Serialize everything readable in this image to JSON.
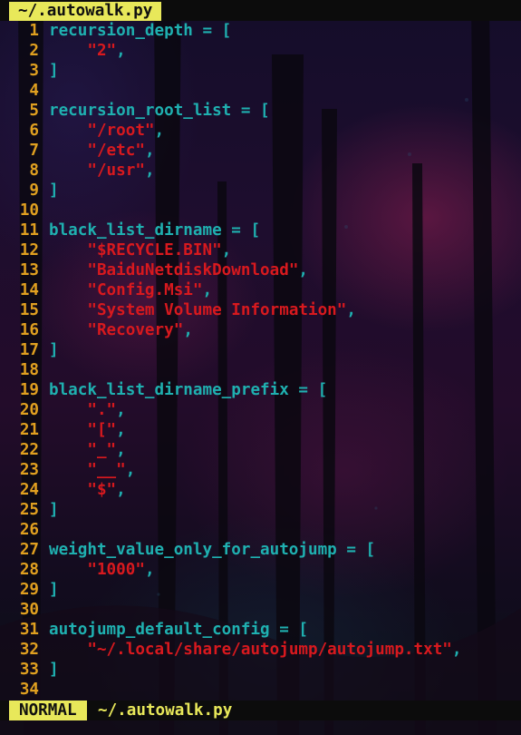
{
  "tabline": {
    "active_tab": "~/.autowalk.py"
  },
  "lines": [
    {
      "n": "1",
      "tokens": [
        {
          "t": "recursion_depth",
          "k": "ident"
        },
        {
          "t": " = [",
          "k": "op"
        }
      ]
    },
    {
      "n": "2",
      "tokens": [
        {
          "t": "    ",
          "k": "punct"
        },
        {
          "t": "\"2\"",
          "k": "str"
        },
        {
          "t": ",",
          "k": "punct"
        }
      ]
    },
    {
      "n": "3",
      "tokens": [
        {
          "t": "]",
          "k": "op"
        }
      ]
    },
    {
      "n": "4",
      "tokens": []
    },
    {
      "n": "5",
      "tokens": [
        {
          "t": "recursion_root_list",
          "k": "ident"
        },
        {
          "t": " = [",
          "k": "op"
        }
      ]
    },
    {
      "n": "6",
      "tokens": [
        {
          "t": "    ",
          "k": "punct"
        },
        {
          "t": "\"/root\"",
          "k": "str"
        },
        {
          "t": ",",
          "k": "punct"
        }
      ]
    },
    {
      "n": "7",
      "tokens": [
        {
          "t": "    ",
          "k": "punct"
        },
        {
          "t": "\"/etc\"",
          "k": "str"
        },
        {
          "t": ",",
          "k": "punct"
        }
      ]
    },
    {
      "n": "8",
      "tokens": [
        {
          "t": "    ",
          "k": "punct"
        },
        {
          "t": "\"/usr\"",
          "k": "str"
        },
        {
          "t": ",",
          "k": "punct"
        }
      ]
    },
    {
      "n": "9",
      "tokens": [
        {
          "t": "]",
          "k": "op"
        }
      ]
    },
    {
      "n": "10",
      "tokens": []
    },
    {
      "n": "11",
      "tokens": [
        {
          "t": "black_list_dirname",
          "k": "ident"
        },
        {
          "t": " = [",
          "k": "op"
        }
      ]
    },
    {
      "n": "12",
      "tokens": [
        {
          "t": "    ",
          "k": "punct"
        },
        {
          "t": "\"$RECYCLE.BIN\"",
          "k": "str"
        },
        {
          "t": ",",
          "k": "punct"
        }
      ]
    },
    {
      "n": "13",
      "tokens": [
        {
          "t": "    ",
          "k": "punct"
        },
        {
          "t": "\"BaiduNetdiskDownload\"",
          "k": "str"
        },
        {
          "t": ",",
          "k": "punct"
        }
      ]
    },
    {
      "n": "14",
      "tokens": [
        {
          "t": "    ",
          "k": "punct"
        },
        {
          "t": "\"Config.Msi\"",
          "k": "str"
        },
        {
          "t": ",",
          "k": "punct"
        }
      ]
    },
    {
      "n": "15",
      "tokens": [
        {
          "t": "    ",
          "k": "punct"
        },
        {
          "t": "\"System Volume Information\"",
          "k": "str"
        },
        {
          "t": ",",
          "k": "punct"
        }
      ]
    },
    {
      "n": "16",
      "tokens": [
        {
          "t": "    ",
          "k": "punct"
        },
        {
          "t": "\"Recovery\"",
          "k": "str"
        },
        {
          "t": ",",
          "k": "punct"
        }
      ]
    },
    {
      "n": "17",
      "tokens": [
        {
          "t": "]",
          "k": "op"
        }
      ]
    },
    {
      "n": "18",
      "tokens": []
    },
    {
      "n": "19",
      "tokens": [
        {
          "t": "black_list_dirname_prefix",
          "k": "ident"
        },
        {
          "t": " = [",
          "k": "op"
        }
      ]
    },
    {
      "n": "20",
      "tokens": [
        {
          "t": "    ",
          "k": "punct"
        },
        {
          "t": "\".\"",
          "k": "str"
        },
        {
          "t": ",",
          "k": "punct"
        }
      ]
    },
    {
      "n": "21",
      "tokens": [
        {
          "t": "    ",
          "k": "punct"
        },
        {
          "t": "\"[\"",
          "k": "str"
        },
        {
          "t": ",",
          "k": "punct"
        }
      ]
    },
    {
      "n": "22",
      "tokens": [
        {
          "t": "    ",
          "k": "punct"
        },
        {
          "t": "\"_\"",
          "k": "str"
        },
        {
          "t": ",",
          "k": "punct"
        }
      ]
    },
    {
      "n": "23",
      "tokens": [
        {
          "t": "    ",
          "k": "punct"
        },
        {
          "t": "\"__\"",
          "k": "str"
        },
        {
          "t": ",",
          "k": "punct"
        }
      ]
    },
    {
      "n": "24",
      "tokens": [
        {
          "t": "    ",
          "k": "punct"
        },
        {
          "t": "\"$\"",
          "k": "str"
        },
        {
          "t": ",",
          "k": "punct"
        }
      ]
    },
    {
      "n": "25",
      "tokens": [
        {
          "t": "]",
          "k": "op"
        }
      ]
    },
    {
      "n": "26",
      "tokens": []
    },
    {
      "n": "27",
      "tokens": [
        {
          "t": "weight_value_only_for_autojump",
          "k": "ident"
        },
        {
          "t": " = [",
          "k": "op"
        }
      ]
    },
    {
      "n": "28",
      "tokens": [
        {
          "t": "    ",
          "k": "punct"
        },
        {
          "t": "\"1000\"",
          "k": "str"
        },
        {
          "t": ",",
          "k": "punct"
        }
      ]
    },
    {
      "n": "29",
      "tokens": [
        {
          "t": "]",
          "k": "op"
        }
      ]
    },
    {
      "n": "30",
      "tokens": []
    },
    {
      "n": "31",
      "tokens": [
        {
          "t": "autojump_default_config",
          "k": "ident"
        },
        {
          "t": " = [",
          "k": "op"
        }
      ]
    },
    {
      "n": "32",
      "tokens": [
        {
          "t": "    ",
          "k": "punct"
        },
        {
          "t": "\"~/.local/share/autojump/autojump.txt\"",
          "k": "str"
        },
        {
          "t": ",",
          "k": "punct"
        }
      ]
    },
    {
      "n": "33",
      "tokens": [
        {
          "t": "]",
          "k": "op"
        }
      ]
    },
    {
      "n": "34",
      "tokens": []
    }
  ],
  "statusline": {
    "mode": "NORMAL",
    "filename": "~/.autowalk.py"
  },
  "colors": {
    "line_number": "#e0a020",
    "identifier": "#1fb0b0",
    "string": "#d8191e",
    "accent_bar": "#e8e85a"
  }
}
